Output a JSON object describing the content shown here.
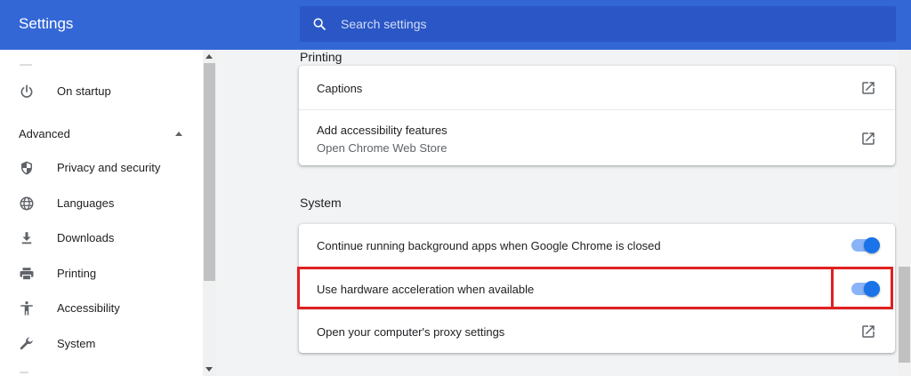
{
  "header": {
    "title": "Settings",
    "search_placeholder": "Search settings"
  },
  "sidebar": {
    "on_startup": "On startup",
    "advanced": "Advanced",
    "items": [
      {
        "label": "Privacy and security",
        "icon": "shield-icon"
      },
      {
        "label": "Languages",
        "icon": "globe-icon"
      },
      {
        "label": "Downloads",
        "icon": "download-icon"
      },
      {
        "label": "Printing",
        "icon": "printer-icon"
      },
      {
        "label": "Accessibility",
        "icon": "accessibility-icon"
      },
      {
        "label": "System",
        "icon": "wrench-icon"
      }
    ]
  },
  "main": {
    "printing_title": "Printing",
    "accessibility_card": {
      "captions": "Captions",
      "add_features": "Add accessibility features",
      "add_features_sub": "Open Chrome Web Store"
    },
    "system_title": "System",
    "system_card": {
      "background_apps": "Continue running background apps when Google Chrome is closed",
      "background_apps_on": true,
      "hardware_accel": "Use hardware acceleration when available",
      "hardware_accel_on": true,
      "proxy": "Open your computer's proxy settings"
    }
  },
  "colors": {
    "header": "#3367d6",
    "toggle_on": "#1a73e8",
    "highlight": "#e02020"
  }
}
